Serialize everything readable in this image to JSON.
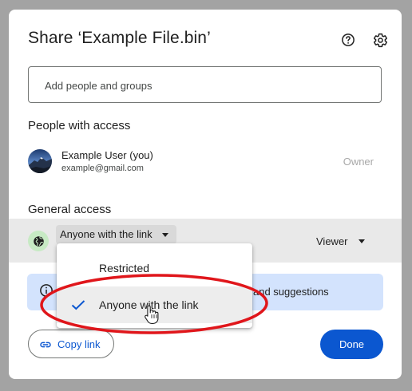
{
  "dialog": {
    "title": "Share ‘Example File.bin’",
    "help_icon": "help-circle-icon",
    "settings_icon": "gear-icon"
  },
  "search": {
    "placeholder": "Add people and groups",
    "value": ""
  },
  "people": {
    "heading": "People with access",
    "users": [
      {
        "name": "Example User (you)",
        "email": "example@gmail.com",
        "role": "Owner"
      }
    ]
  },
  "general_access": {
    "heading": "General access",
    "icon": "globe-icon",
    "selected": "Anyone with the link",
    "role": "Viewer",
    "menu": {
      "options": [
        "Restricted",
        "Anyone with the link"
      ],
      "selected_index": 1
    }
  },
  "banner": {
    "icon": "info-icon",
    "text_visible": "and suggestions"
  },
  "footer": {
    "copy_link_label": "Copy link",
    "copy_icon": "link-icon",
    "done_label": "Done"
  },
  "annotation": {
    "highlight_color": "#e0161b"
  },
  "colors": {
    "primary": "#0b57d0",
    "banner_bg": "#d3e3fd",
    "globe_bg": "#c7eac4"
  }
}
